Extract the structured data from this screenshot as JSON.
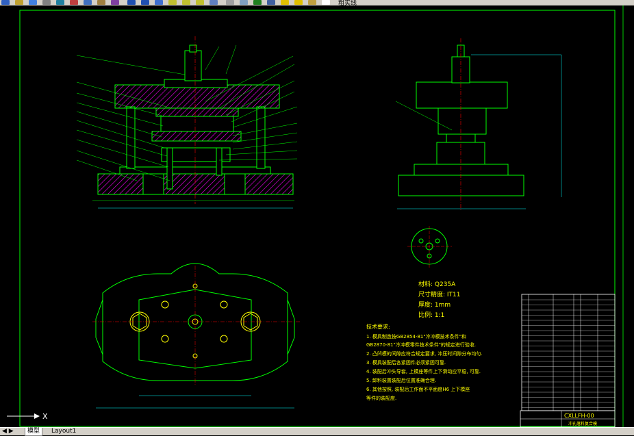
{
  "colors": {
    "background": "#000000",
    "frame": "#00ff00",
    "lines": "#00ff00",
    "hatch": "#ff00ff",
    "dims": "#00ffff",
    "text_yellow": "#ffff00",
    "ui_gray": "#d4d0c8"
  },
  "toolbar": {
    "icons": [
      "new-icon",
      "open-icon",
      "save-icon",
      "print-icon",
      "preview-icon",
      "cut-icon",
      "copy-icon",
      "paste-icon",
      "match-icon",
      "undo-icon",
      "redo-icon",
      "pan-icon",
      "zoom-icon",
      "zoom-window-icon",
      "zoom-prev-icon",
      "properties-icon",
      "designcenter-icon",
      "toolpalette-icon",
      "help-icon",
      "layer-icon",
      "bulb-icon",
      "sun-icon",
      "lock-icon",
      "color-icon"
    ],
    "layer_name": "粗实线"
  },
  "tabs": {
    "model": "模型",
    "layout": "Layout1"
  },
  "drawing": {
    "material_label": "材料: Q235A",
    "tolerance_label": "尺寸精度: IT11",
    "thickness_label": "厚度: 1mm",
    "scale_label": "比例: 1:1",
    "tech_req_title": "技术要求:",
    "tech_req": [
      "1. 模具制造按GB2854-81\"冷冲模技术条件\"和",
      "GB2870-81\"冷冲模零件技术条件\"的规定进行验收.",
      "2. 凸凹模的间隙应符合规定要求, 冲压时间隙分布均匀.",
      "3. 模具装配后各紧固件必须紧固可靠.",
      "4. 装配后冲头导套, 上模座等件上下滑动应平稳, 可靠.",
      "5. 卸料装置装配后位置准确合理.",
      "6. 其他按照, 装配后工作面不平面度H6 上下模座",
      "等件的装配度."
    ],
    "drawing_number": "CXLLFH-00",
    "title_block_name": "冲孔落料复合模"
  }
}
